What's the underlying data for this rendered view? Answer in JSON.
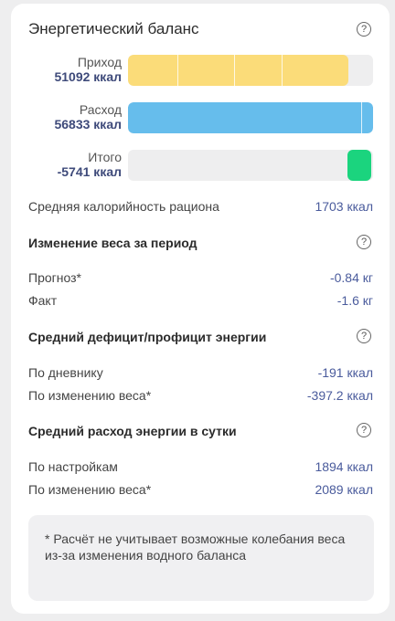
{
  "header": {
    "title": "Энергетический баланс",
    "help_glyph": "?"
  },
  "bars": {
    "income": {
      "label": "Приход",
      "value": "51092 ккал",
      "fill_fraction": 0.9
    },
    "expense": {
      "label": "Расход",
      "value": "56833 ккал",
      "fill_fraction": 1.0
    },
    "total": {
      "label": "Итого",
      "value": "-5741 ккал"
    },
    "colors": {
      "income": "#fbdc79",
      "expense": "#66bdec",
      "total": "#1bd47e",
      "track": "#eeeeef"
    }
  },
  "avg_calories": {
    "label": "Средняя калорийность рациона",
    "value": "1703 ккал"
  },
  "weight_change": {
    "title": "Изменение веса за период",
    "rows": [
      {
        "label": "Прогноз*",
        "value": "-0.84 кг"
      },
      {
        "label": "Факт",
        "value": "-1.6 кг"
      }
    ]
  },
  "deficit": {
    "title": "Средний дефицит/профицит энергии",
    "rows": [
      {
        "label": "По дневнику",
        "value": "-191 ккал"
      },
      {
        "label": "По изменению веса*",
        "value": "-397.2 ккал"
      }
    ]
  },
  "daily_expense": {
    "title": "Средний расход энергии в сутки",
    "rows": [
      {
        "label": "По настройкам",
        "value": "1894 ккал"
      },
      {
        "label": "По изменению веса*",
        "value": "2089 ккал"
      }
    ]
  },
  "note": {
    "text": "* Расчёт не учитывает возможные колебания веса из-за изменения водного баланса"
  }
}
